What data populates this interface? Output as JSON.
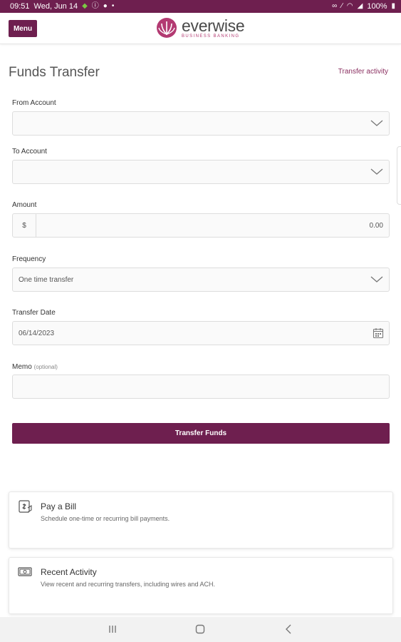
{
  "status_bar": {
    "time": "09:51",
    "date": "Wed, Jun 14",
    "battery": "100%"
  },
  "header": {
    "menu_label": "Menu",
    "brand_name": "everwise",
    "brand_sub": "BUSINESS BANKING"
  },
  "page": {
    "title": "Funds Transfer",
    "activity_link": "Transfer activity"
  },
  "form": {
    "from_account": {
      "label": "From Account",
      "value": ""
    },
    "to_account": {
      "label": "To Account",
      "value": ""
    },
    "amount": {
      "label": "Amount",
      "currency": "$",
      "placeholder": "0.00"
    },
    "frequency": {
      "label": "Frequency",
      "value": "One time transfer"
    },
    "transfer_date": {
      "label": "Transfer Date",
      "value": "06/14/2023"
    },
    "memo": {
      "label": "Memo",
      "optional": "(optional)",
      "value": ""
    },
    "submit_label": "Transfer Funds"
  },
  "cards": [
    {
      "title": "Pay a Bill",
      "description": "Schedule one-time or recurring bill payments.",
      "icon": "bill-icon"
    },
    {
      "title": "Recent Activity",
      "description": "View recent and recurring transfers, including wires and ACH.",
      "icon": "cash-icon"
    }
  ],
  "colors": {
    "brand": "#6e1f4f",
    "accent": "#b33a72"
  }
}
